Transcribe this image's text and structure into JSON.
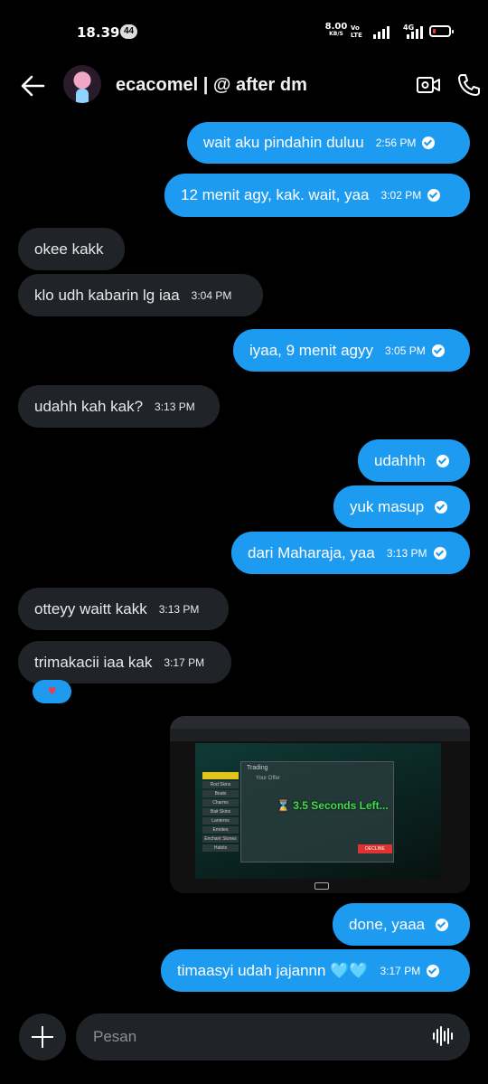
{
  "status": {
    "time": "18.39",
    "notif_count": "44",
    "net_speed": "8.00",
    "net_unit": "KB/S",
    "volte_top": "Vo ",
    "volte_bottom": "LTE",
    "network": "4G"
  },
  "header": {
    "title": "ecacomel | @ after dm",
    "icons": [
      "back-arrow-icon",
      "video-call-icon",
      "phone-icon"
    ]
  },
  "messages": [
    {
      "dir": "out",
      "text": "wait aku pindahin duluu",
      "time": "2:56 PM",
      "read": true
    },
    {
      "dir": "out",
      "text": "12 menit agy, kak. wait, yaa",
      "time": "3:02 PM",
      "read": true
    },
    {
      "dir": "in",
      "text": "okee kakk",
      "time": ""
    },
    {
      "dir": "in",
      "text": "klo udh kabarin lg iaa",
      "time": "3:04 PM"
    },
    {
      "dir": "out",
      "text": "iyaa, 9 menit agyy",
      "time": "3:05 PM",
      "read": true
    },
    {
      "dir": "in",
      "text": "udahh kah kak?",
      "time": "3:13 PM"
    },
    {
      "dir": "out",
      "text": "udahhh",
      "time": "",
      "read": true
    },
    {
      "dir": "out",
      "text": "yuk masup",
      "time": "",
      "read": true
    },
    {
      "dir": "out",
      "text": "dari Maharaja, yaa",
      "time": "3:13 PM",
      "read": true
    },
    {
      "dir": "in",
      "text": "otteyy waitt kakk",
      "time": "3:13 PM"
    },
    {
      "dir": "in",
      "text": "trimakacii iaa kak",
      "time": "3:17 PM"
    },
    {
      "dir": "out",
      "text": "done, yaaa",
      "time": "",
      "read": true
    },
    {
      "dir": "out",
      "text": "timaasyi udah jajannn 🩵🩵",
      "time": "3:17 PM",
      "read": true
    }
  ],
  "reaction": "♥",
  "image": {
    "countdown": "⌛ 3.5 Seconds Left...",
    "menu": [
      "Rod Skins",
      "Boats",
      "Charms",
      "Bait Skins",
      "Lanterns",
      "Emotes",
      "Enchant Stones",
      "Habits"
    ],
    "decline": "DECLINE",
    "panel_title": "Trading",
    "your_offer": "Your Offer"
  },
  "composer": {
    "placeholder": "Pesan"
  }
}
